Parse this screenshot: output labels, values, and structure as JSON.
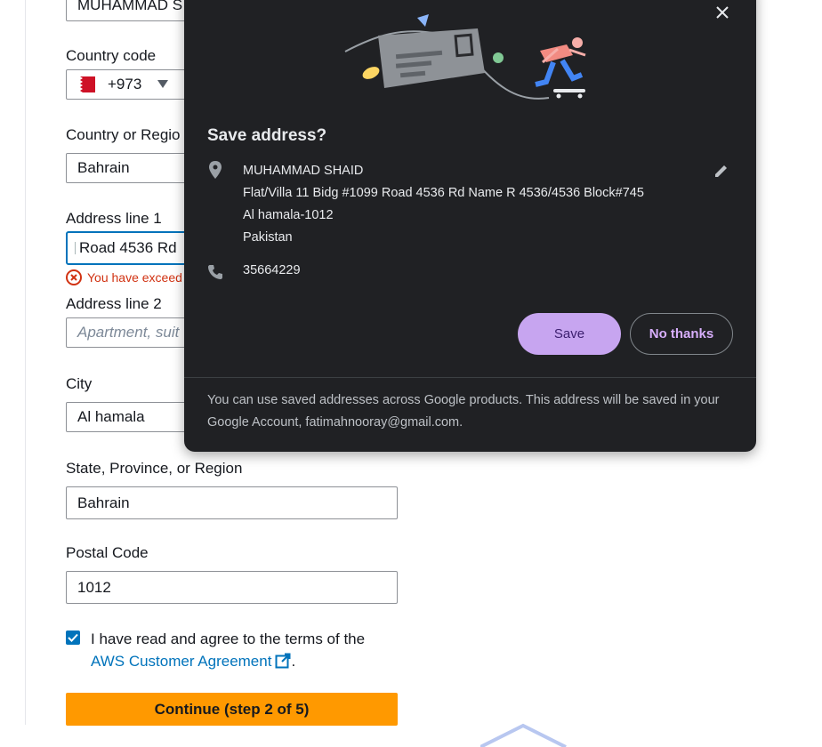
{
  "form": {
    "name_value": "MUHAMMAD S",
    "country_code": {
      "label": "Country code",
      "value": "+973"
    },
    "country": {
      "label": "Country or Regio",
      "value": "Bahrain"
    },
    "address1": {
      "label": "Address line 1",
      "value": "Road 4536 Rd",
      "error": "You have exceed"
    },
    "address2": {
      "label": "Address line 2",
      "placeholder": "Apartment, suit"
    },
    "city": {
      "label": "City",
      "value": "Al hamala"
    },
    "state": {
      "label": "State, Province, or Region",
      "value": "Bahrain"
    },
    "postal": {
      "label": "Postal Code",
      "value": "1012"
    },
    "agree_text": "I have read and agree to the terms of the",
    "agree_link": "AWS Customer Agreement",
    "agree_period": ".",
    "agree_checked": true,
    "continue_label": "Continue (step 2 of 5)"
  },
  "popup": {
    "title": "Save address?",
    "name": "MUHAMMAD SHAID",
    "line1": "Flat/Villa 11 Bidg #1099 Road 4536 Rd Name R 4536/4536 Block#745",
    "line2": "Al hamala-1012",
    "line3": "Pakistan",
    "phone": "35664229",
    "save_label": "Save",
    "no_thanks_label": "No thanks",
    "footer": "You can use saved addresses across Google products. This address will be saved in your Google Account, fatimahnooray@gmail.com."
  },
  "colors": {
    "accent": "#0073bb",
    "continue": "#ff9900",
    "error": "#d13212",
    "popup_bg": "#202124",
    "save_bg": "#c7a5f0"
  },
  "icons": [
    "close-icon",
    "location-pin-icon",
    "edit-pencil-icon",
    "phone-icon",
    "external-link-icon",
    "error-icon",
    "checkmark-icon",
    "dropdown-arrow-icon",
    "bahrain-flag-icon"
  ]
}
